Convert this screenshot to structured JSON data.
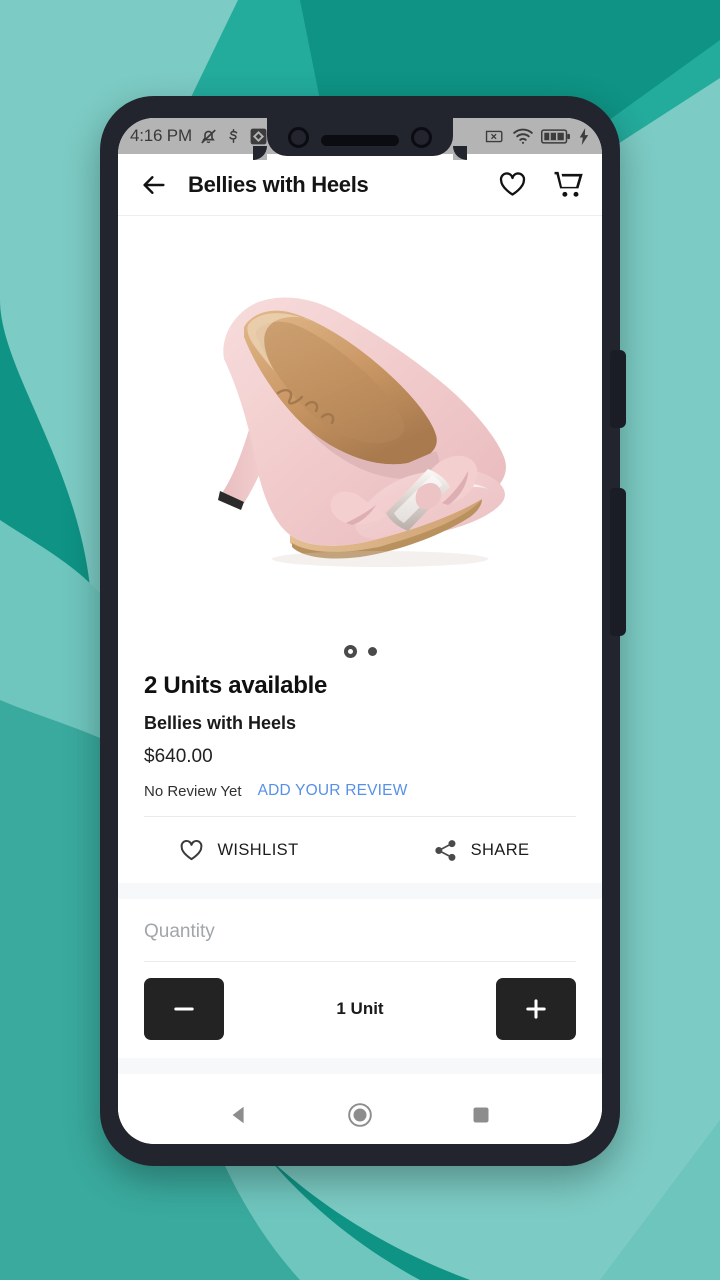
{
  "background": {
    "base_color": "#7CCBC4",
    "accent_color": "#0E9384",
    "mid_color": "#2BB3A3"
  },
  "phone": {
    "frame_color": "#22242e",
    "power_button": "power-button",
    "volume_button": "volume-button"
  },
  "status_bar": {
    "time": "4:16 PM",
    "left_icons": [
      "bell-muted-icon",
      "skype-s-icon",
      "app-diamond-icon"
    ],
    "right_icons": [
      "no-sim-icon",
      "wifi-icon",
      "battery-icon",
      "charging-bolt-icon"
    ],
    "battery_level": "100",
    "background_color": "#b4b4b4"
  },
  "app_bar": {
    "back_icon": "back-arrow-icon",
    "title": "Bellies with Heels",
    "wishlist_icon": "heart-outline-icon",
    "cart_icon": "shopping-cart-icon"
  },
  "gallery": {
    "image_alt": "pink-bellies-with-heels-shoe",
    "total_pages": 2,
    "current_page": 1
  },
  "product": {
    "stock_status": "2 Units available",
    "name": "Bellies with Heels",
    "price": "$640.00",
    "review_status": "No Review Yet",
    "add_review_label": "ADD YOUR REVIEW",
    "add_review_color": "#5790E8"
  },
  "social_actions": {
    "wishlist_label": "WISHLIST",
    "wishlist_icon": "heart-outline-icon",
    "share_label": "SHARE",
    "share_icon": "share-nodes-icon"
  },
  "quantity": {
    "label": "Quantity",
    "decrement_icon": "minus-icon",
    "value": "1 Unit",
    "increment_icon": "plus-icon"
  },
  "nav_bar": {
    "back_icon": "nav-back-triangle-icon",
    "home_icon": "nav-home-circle-icon",
    "recents_icon": "nav-recents-square-icon"
  }
}
